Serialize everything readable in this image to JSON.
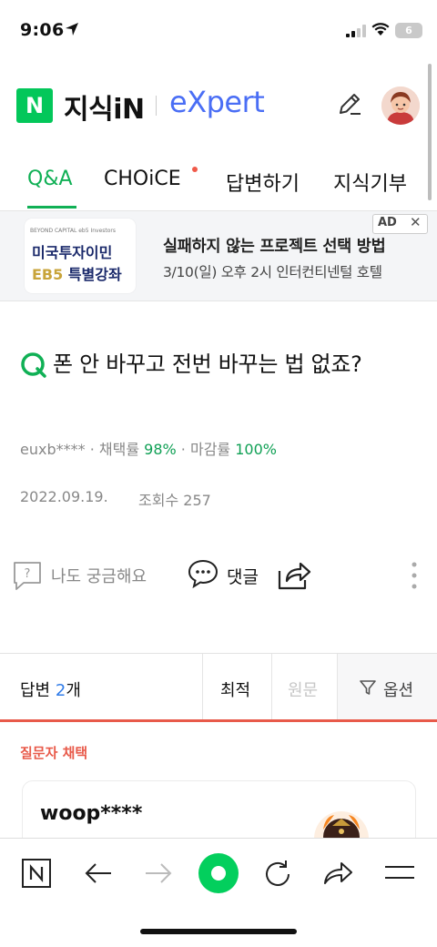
{
  "status_bar": {
    "time": "9:06",
    "battery": "6"
  },
  "header": {
    "logo_letter": "N",
    "brand": "지식iN",
    "expert": "eXpert"
  },
  "tabs": [
    {
      "label": "Q&A",
      "active": true
    },
    {
      "label": "CHOiCE",
      "has_dot": true
    },
    {
      "label": "답변하기"
    },
    {
      "label": "지식기부"
    }
  ],
  "ad": {
    "badge": "AD",
    "close": "✕",
    "card_top": "BEYOND CAPITAL   eb5 Investors",
    "card_line1": "미국투자이민",
    "card_eb5": "EB5",
    "card_line2_rest": " 특별강좌",
    "title": "실패하지 않는 프로젝트 선택 방법",
    "subtitle": "3/10(일) 오후 2시 인터컨티넨털 호텔"
  },
  "question": {
    "title": "폰 안 바꾸고 전번 바꾸는 법 없죠?",
    "author": "euxb****",
    "adopt_label": "채택률",
    "adopt_rate": "98%",
    "close_label": "마감률",
    "close_rate": "100%",
    "date": "2022.09.19.",
    "views_label": "조회수",
    "views": "257"
  },
  "actions": {
    "curious": "나도 궁금해요",
    "comment": "댓글"
  },
  "answers": {
    "label": "답변",
    "count": "2",
    "count_suffix": "개",
    "sort_best": "최적",
    "sort_original": "원문",
    "options": "옵션",
    "chosen_label": "질문자 채택",
    "first_user": "woop****"
  },
  "colors": {
    "naver_green": "#03c75a",
    "expert_blue": "#4a6ef5",
    "accent_red": "#e85a4a"
  }
}
